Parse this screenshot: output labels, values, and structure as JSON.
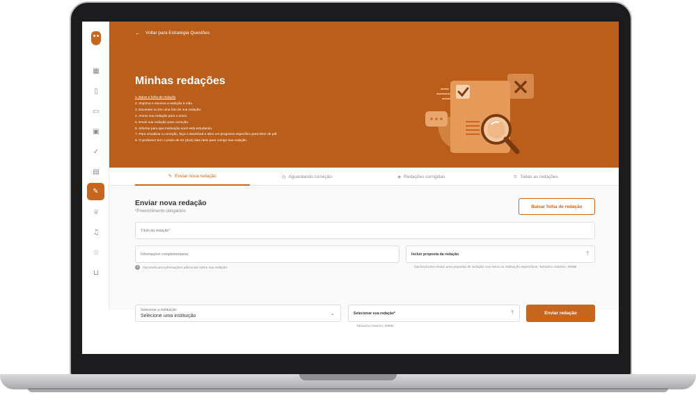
{
  "hero": {
    "back_label": "Voltar para Estratégia Questões",
    "title": "Minhas redações",
    "steps": [
      "1. Baixe a folha de redação",
      "2. Imprima e escreva a redação à mão.",
      "3. Escaneie ou tire uma foto de sua redação.",
      "4. Anexe sua redação para o envio.",
      "5. Envie sua redação para correção.",
      "6. Informe para que instituição você está estudando.",
      "7. Para visualizar a correção, faça o download e abra um programa específico para leitor de pdf.",
      "6. O professor tem o prazo de 02 (dois) dias úteis para corrigir sua redação."
    ]
  },
  "tabs": [
    {
      "label": "Enviar nova redação",
      "icon": "pencil-icon",
      "active": true
    },
    {
      "label": "Aguardando correção",
      "icon": "clock-icon",
      "active": false
    },
    {
      "label": "Redações corrigidas",
      "icon": "shield-icon",
      "active": false
    },
    {
      "label": "Todas as redações",
      "icon": "list-icon",
      "active": false
    }
  ],
  "form": {
    "title": "Enviar nova redação",
    "required_note": "*Preenchimento obrigatório",
    "download_button": "Baixar folha de redação",
    "title_field_label": "Título da redação*",
    "info_field_label": "Informações complementares",
    "info_hint": "Opcional para informações adicionais sobre sua redação",
    "proposal_label": "Incluir proposta da redação",
    "proposal_hint": "Opcional para enviar uma proposta de redação com tema ou instituição específicos. Tamanho máximo: 30MB",
    "institution_label": "Selecione a instituição",
    "institution_value": "Selecione uma instituição",
    "select_essay_label": "Selecionar sua redação*",
    "select_essay_hint": "Tamanho máximo: 30MB",
    "submit_button": "Enviar redação"
  },
  "sidebar_icons": [
    "dashboard-icon",
    "book-icon",
    "tablet-icon",
    "monitor-icon",
    "check-circle-icon",
    "document-check-icon",
    "essay-icon",
    "trophy-icon",
    "music-icon",
    "star-icon",
    "cart-icon"
  ],
  "colors": {
    "accent": "#c7661e",
    "hero": "#ba5e1c"
  }
}
